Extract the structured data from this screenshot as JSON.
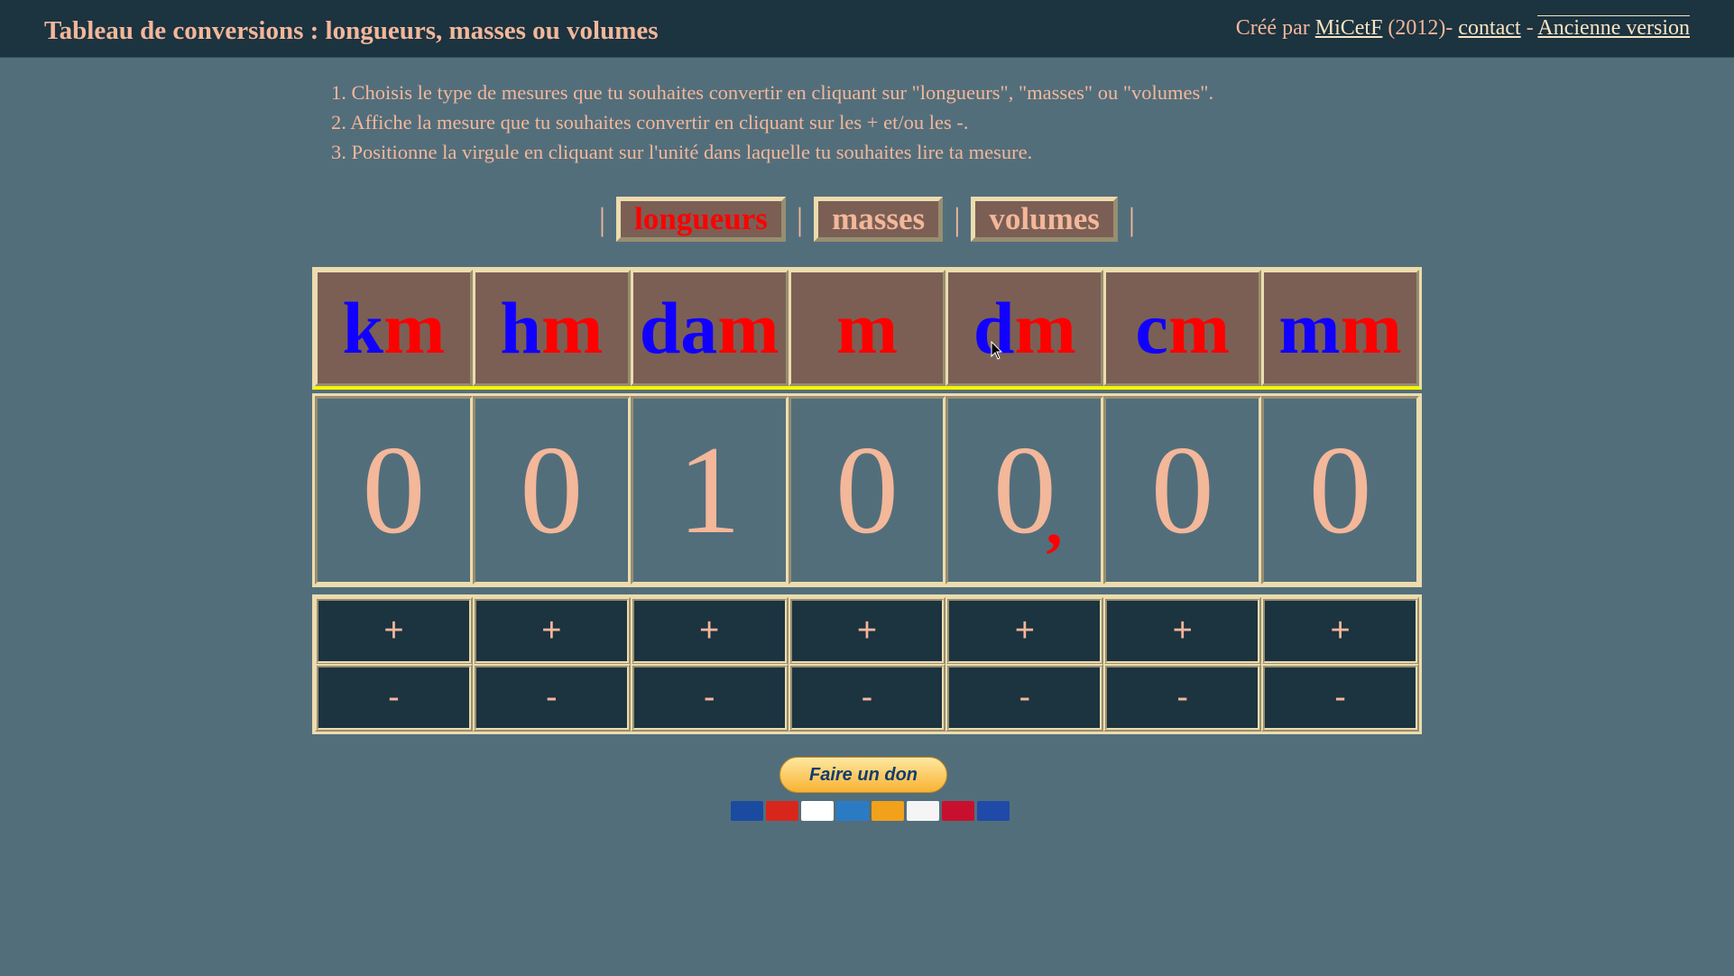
{
  "header": {
    "title": "Tableau de conversions : longueurs, masses ou volumes",
    "credit_prefix": "Créé par",
    "author_link": "MiCetF",
    "year_text": "(2012)-",
    "contact_link": "contact",
    "separator": "-",
    "old_version_link": "Ancienne version"
  },
  "instructions": [
    "1. Choisis le type de mesures que tu souhaites convertir en cliquant sur \"longueurs\", \"masses\" ou \"volumes\".",
    "2. Affiche la mesure que tu souhaites convertir en cliquant sur les + et/ou les -.",
    "3. Positionne la virgule en cliquant sur l'unité dans laquelle tu souhaites lire ta mesure."
  ],
  "tabs": {
    "separator": "|",
    "items": [
      {
        "label": "longueurs",
        "active": true
      },
      {
        "label": "masses",
        "active": false
      },
      {
        "label": "volumes",
        "active": false
      }
    ]
  },
  "units": [
    {
      "prefix": "k",
      "base": "m"
    },
    {
      "prefix": "h",
      "base": "m"
    },
    {
      "prefix": "da",
      "base": "m"
    },
    {
      "prefix": "",
      "base": "m"
    },
    {
      "prefix": "d",
      "base": "m"
    },
    {
      "prefix": "c",
      "base": "m"
    },
    {
      "prefix": "m",
      "base": "m"
    }
  ],
  "digits": [
    "0",
    "0",
    "1",
    "0",
    "0",
    "0",
    "0"
  ],
  "comma": {
    "symbol": ",",
    "after_unit_index": 4
  },
  "controls": {
    "plus": "+",
    "minus": "-"
  },
  "donate": {
    "label": "Faire un don",
    "cards": [
      {
        "name": "Maestro",
        "color": "#1a4ba0"
      },
      {
        "name": "MasterCard",
        "color": "#d9261c"
      },
      {
        "name": "VISA",
        "color": "#ffffff"
      },
      {
        "name": "American Express",
        "color": "#2b7bc4"
      },
      {
        "name": "Aurore",
        "color": "#f2a11a"
      },
      {
        "name": "Sofinco",
        "color": "#f5f5f5"
      },
      {
        "name": "4 étoiles",
        "color": "#c8102e"
      },
      {
        "name": "CB",
        "color": "#1f4aa8"
      }
    ]
  }
}
